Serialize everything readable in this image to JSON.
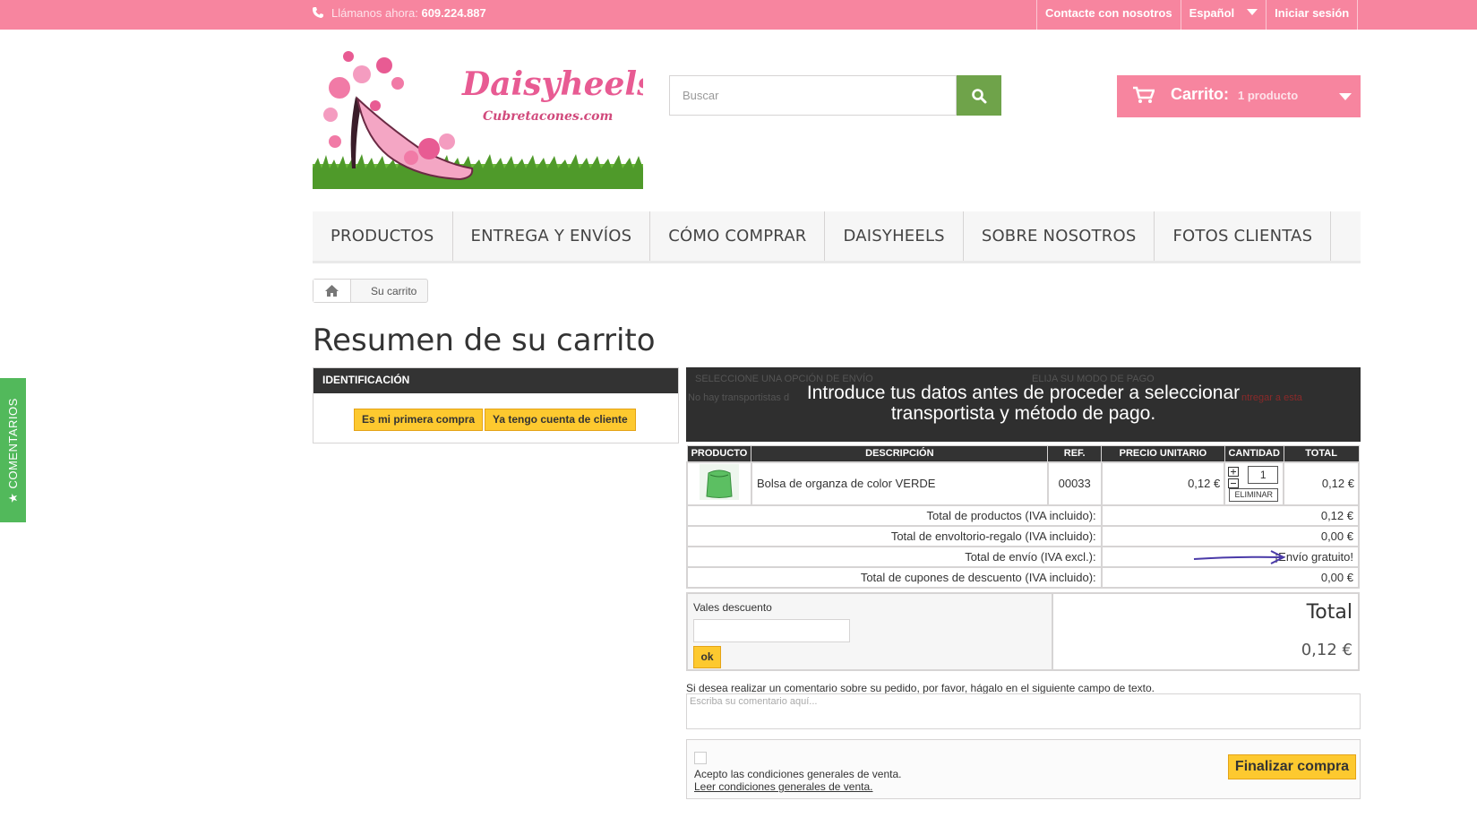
{
  "topbar": {
    "phone_label": "Llámanos ahora:",
    "phone_number": "609.224.887",
    "links": [
      "Contacte con nosotros",
      "Español",
      "Iniciar sesión"
    ]
  },
  "logo": {
    "brand": "Daisyheels",
    "sub": "Cubretacones.com"
  },
  "search": {
    "placeholder": "Buscar"
  },
  "cart": {
    "label": "Carrito:",
    "qty": "1 producto"
  },
  "nav": [
    "PRODUCTOS",
    "ENTREGA Y ENVÍOS",
    "CÓMO COMPRAR",
    "DAISYHEELS",
    "SOBRE NOSOTROS",
    "FOTOS CLIENTAS"
  ],
  "breadcrumb": {
    "current": "Su carrito"
  },
  "side_tab": "★ COMENTARIOS",
  "page_title": "Resumen de su carrito",
  "identification": {
    "header": "IDENTIFICACIÓN",
    "first_purchase": "Es mi primera compra",
    "have_account": "Ya tengo cuenta de cliente"
  },
  "shipping": {
    "header_shipping": "SELECCIONE UNA OPCIÓN DE ENVÍO",
    "header_payment": "ELIJA SU MODO DE PAGO",
    "no_carriers": "No hay transportistas d",
    "deliver_to": "ntregar a esta",
    "overlay_line1": "Introduce tus datos antes de proceder a seleccionar",
    "overlay_line2": "transportista y método de pago."
  },
  "table": {
    "headers": [
      "PRODUCTO",
      "DESCRIPCIÓN",
      "REF.",
      "PRECIO UNITARIO",
      "CANTIDAD",
      "TOTAL"
    ],
    "item": {
      "description": "Bolsa de organza de color VERDE",
      "ref": "00033",
      "unit_price": "0,12 €",
      "quantity": "1",
      "remove": "ELIMINAR",
      "total": "0,12 €"
    },
    "summary": [
      {
        "label": "Total de productos (IVA incluido):",
        "value": "0,12 €"
      },
      {
        "label": "Total de envoltorio-regalo (IVA incluido):",
        "value": "0,00 €"
      },
      {
        "label": "Total de envío (IVA excl.):",
        "value": "¡Envío gratuito!"
      },
      {
        "label": "Total de cupones de descuento (IVA incluido):",
        "value": "0,00 €"
      }
    ]
  },
  "vouchers": {
    "label": "Vales descuento",
    "ok": "ok"
  },
  "total": {
    "label": "Total",
    "value": "0,12 €"
  },
  "comment": {
    "label": "Si desea realizar un comentario sobre su pedido, por favor, hágalo en el siguiente campo de texto.",
    "placeholder": "Escriba su comentario aquí..."
  },
  "terms": {
    "accept": "Acepto las condiciones generales de venta.",
    "read": "Leer condiciones generales de venta.",
    "finish": "Finalizar compra"
  },
  "colors": {
    "topbar": "#f7859f",
    "search_button": "#6fa34a",
    "side_tab": "#52b95b",
    "button": "#fdc92f"
  }
}
